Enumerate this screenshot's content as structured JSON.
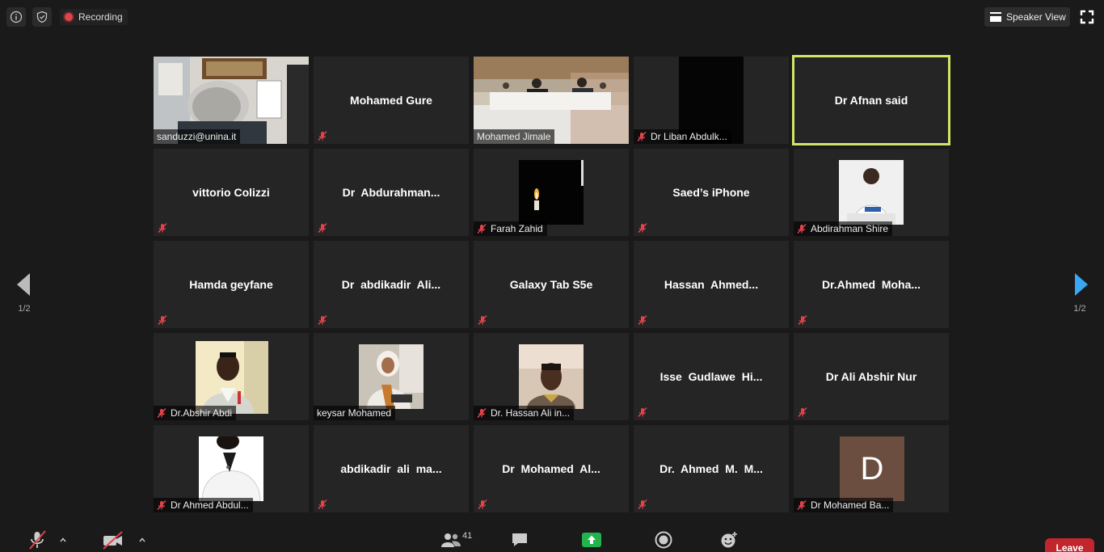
{
  "topbar": {
    "recording_label": "Recording",
    "speaker_view_label": "Speaker View"
  },
  "pager": {
    "left_page": "1/2",
    "right_page": "1/2"
  },
  "toolbar": {
    "participants_count": "41",
    "leave_label": "Leave"
  },
  "colors": {
    "active_border": "#d3e569",
    "leave_red": "#c1262f",
    "share_green": "#24b24f",
    "mute_red": "#e0434b",
    "nav_blue": "#3aa7f2"
  },
  "tiles": [
    {
      "kind": "photo",
      "label": "sanduzzi@unina.it",
      "muted": false
    },
    {
      "kind": "name",
      "text": "Mohamed Gure",
      "muted": true
    },
    {
      "kind": "photo",
      "label": "Mohamed Jimale",
      "muted": false
    },
    {
      "kind": "photo",
      "label": "Dr Liban Abdulk...",
      "muted": true
    },
    {
      "kind": "name",
      "text": "Dr Afnan said",
      "muted": false,
      "active": true
    },
    {
      "kind": "name",
      "text": "vittorio Colizzi",
      "muted": true
    },
    {
      "kind": "name",
      "text": "Dr  Abdurahman...",
      "muted": true
    },
    {
      "kind": "thumb",
      "label": "Farah Zahid",
      "muted": true
    },
    {
      "kind": "name",
      "text": "Saed’s iPhone",
      "muted": true
    },
    {
      "kind": "thumb",
      "label": "Abdirahman Shire",
      "muted": true
    },
    {
      "kind": "name",
      "text": "Hamda geyfane",
      "muted": true
    },
    {
      "kind": "name",
      "text": "Dr  abdikadir  Ali...",
      "muted": true
    },
    {
      "kind": "name",
      "text": "Galaxy Tab S5e",
      "muted": true
    },
    {
      "kind": "name",
      "text": "Hassan  Ahmed...",
      "muted": true
    },
    {
      "kind": "name",
      "text": "Dr.Ahmed  Moha...",
      "muted": true
    },
    {
      "kind": "thumb",
      "label": "Dr.Abshir Abdi",
      "muted": true
    },
    {
      "kind": "thumb",
      "label": "keysar Mohamed",
      "muted": false
    },
    {
      "kind": "thumb",
      "label": "Dr. Hassan Ali in...",
      "muted": true
    },
    {
      "kind": "name",
      "text": "Isse  Gudlawe  Hi...",
      "muted": true
    },
    {
      "kind": "name",
      "text": "Dr Ali Abshir Nur",
      "muted": true
    },
    {
      "kind": "thumb",
      "label": "Dr Ahmed Abdul...",
      "muted": true
    },
    {
      "kind": "name",
      "text": "abdikadir  ali  ma...",
      "muted": true
    },
    {
      "kind": "name",
      "text": "Dr  Mohamed  Al...",
      "muted": true
    },
    {
      "kind": "name",
      "text": "Dr.  Ahmed  M.  M...",
      "muted": true
    },
    {
      "kind": "avatar",
      "initial": "D",
      "label": "Dr Mohamed Ba...",
      "muted": true
    }
  ]
}
